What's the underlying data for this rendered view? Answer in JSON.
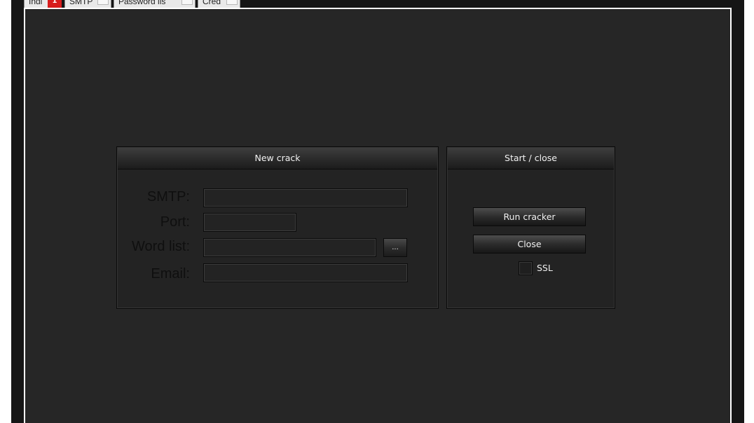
{
  "tabs": [
    {
      "label": "Indi"
    },
    {
      "label": "SMTP"
    },
    {
      "label": "Password lis"
    },
    {
      "label": "Cred"
    }
  ],
  "tab_badge": "1",
  "new_crack": {
    "title": "New crack",
    "smtp_label": "SMTP:",
    "smtp_value": "",
    "port_label": "Port:",
    "port_value": "",
    "wordlist_label": "Word list:",
    "wordlist_value": "",
    "browse_label": "...",
    "email_label": "Email:",
    "email_value": ""
  },
  "start_close": {
    "title": "Start / close",
    "run_label": "Run cracker",
    "close_label": "Close",
    "ssl_label": "SSL",
    "ssl_checked": false
  },
  "colors": {
    "window_bg": "#151515",
    "content_bg": "#262626",
    "panel_header_text": "#f2f2f2",
    "label_text": "#0f0f0f",
    "badge_red": "#d81d1d"
  }
}
